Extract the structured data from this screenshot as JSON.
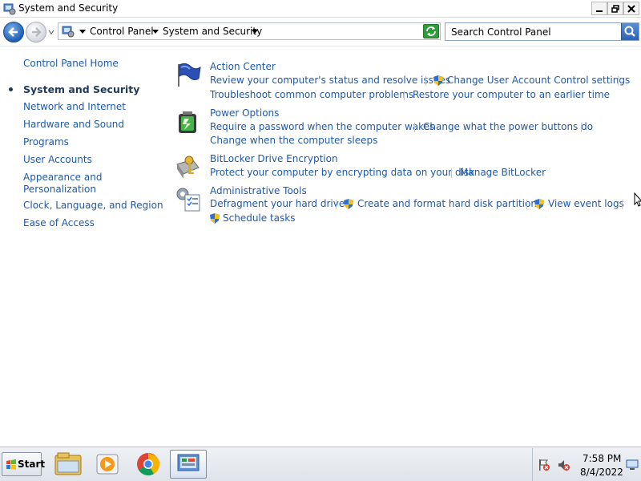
{
  "window": {
    "title": "System and Security",
    "minimize_glyph": "🗕",
    "restore_glyph": "🗗",
    "close_glyph": "✕"
  },
  "address_bar": {
    "breadcrumbs": [
      "Control Panel",
      "System and Security"
    ],
    "search_placeholder": "Search Control Panel"
  },
  "sidebar": {
    "home": "Control Panel Home",
    "items": [
      {
        "label": "System and Security",
        "current": true
      },
      {
        "label": "Network and Internet"
      },
      {
        "label": "Hardware and Sound"
      },
      {
        "label": "Programs"
      },
      {
        "label": "User Accounts"
      },
      {
        "label": "Appearance and",
        "label2": "Personalization"
      },
      {
        "label": "Clock, Language, and Region"
      },
      {
        "label": "Ease of Access"
      }
    ]
  },
  "sections": {
    "action_center": {
      "title": "Action Center",
      "icon": "flag-icon",
      "tasks": [
        "Review your computer's status and resolve issues",
        "Change User Account Control settings",
        "Troubleshoot common computer problems",
        "Restore your computer to an earlier time"
      ]
    },
    "power_options": {
      "title": "Power Options",
      "icon": "battery-icon",
      "tasks": [
        "Require a password when the computer wakes",
        "Change what the power buttons do",
        "Change when the computer sleeps"
      ]
    },
    "bitlocker": {
      "title": "BitLocker Drive Encryption",
      "icon": "bitlocker-key-icon",
      "tasks": [
        "Protect your computer by encrypting data on your disk",
        "Manage BitLocker"
      ]
    },
    "admin_tools": {
      "title": "Administrative Tools",
      "icon": "admin-tools-icon",
      "tasks": [
        "Defragment your hard drive",
        "Create and format hard disk partitions",
        "View event logs",
        "Schedule tasks"
      ]
    }
  },
  "taskbar": {
    "start_label": "Start",
    "apps": [
      "file-explorer-icon",
      "media-player-icon",
      "chrome-icon",
      "control-panel-icon"
    ],
    "clock_time": "7:58 PM",
    "clock_date": "8/4/2022"
  },
  "colors": {
    "link": "#1e5aa8",
    "heading": "#1e395b"
  }
}
